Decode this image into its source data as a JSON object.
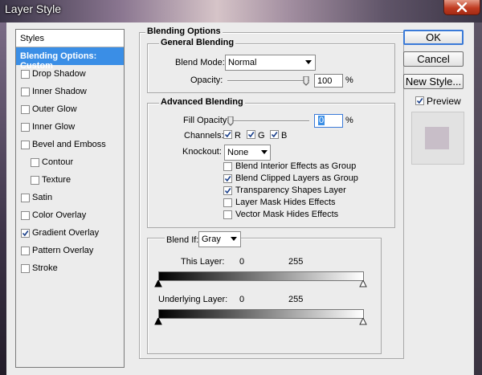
{
  "window": {
    "title": "Layer Style"
  },
  "styles_panel": {
    "header": "Styles",
    "items": [
      {
        "label": "Blending Options: Custom",
        "selected": true,
        "checkbox": false,
        "checked": false,
        "indent": false
      },
      {
        "label": "Drop Shadow",
        "selected": false,
        "checkbox": true,
        "checked": false,
        "indent": false
      },
      {
        "label": "Inner Shadow",
        "selected": false,
        "checkbox": true,
        "checked": false,
        "indent": false
      },
      {
        "label": "Outer Glow",
        "selected": false,
        "checkbox": true,
        "checked": false,
        "indent": false
      },
      {
        "label": "Inner Glow",
        "selected": false,
        "checkbox": true,
        "checked": false,
        "indent": false
      },
      {
        "label": "Bevel and Emboss",
        "selected": false,
        "checkbox": true,
        "checked": false,
        "indent": false
      },
      {
        "label": "Contour",
        "selected": false,
        "checkbox": true,
        "checked": false,
        "indent": true
      },
      {
        "label": "Texture",
        "selected": false,
        "checkbox": true,
        "checked": false,
        "indent": true
      },
      {
        "label": "Satin",
        "selected": false,
        "checkbox": true,
        "checked": false,
        "indent": false
      },
      {
        "label": "Color Overlay",
        "selected": false,
        "checkbox": true,
        "checked": false,
        "indent": false
      },
      {
        "label": "Gradient Overlay",
        "selected": false,
        "checkbox": true,
        "checked": true,
        "indent": false
      },
      {
        "label": "Pattern Overlay",
        "selected": false,
        "checkbox": true,
        "checked": false,
        "indent": false
      },
      {
        "label": "Stroke",
        "selected": false,
        "checkbox": true,
        "checked": false,
        "indent": false
      }
    ]
  },
  "blending": {
    "title": "Blending Options",
    "general": {
      "title": "General Blending",
      "blend_mode_label": "Blend Mode:",
      "blend_mode_value": "Normal",
      "opacity_label": "Opacity:",
      "opacity_value": "100",
      "opacity_fraction": 1.0,
      "percent": "%"
    },
    "advanced": {
      "title": "Advanced Blending",
      "fill_opacity_label": "Fill Opacity:",
      "fill_opacity_value": "0",
      "fill_opacity_fraction": 0.0,
      "percent": "%",
      "channels_label": "Channels:",
      "channels": [
        {
          "label": "R",
          "checked": true
        },
        {
          "label": "G",
          "checked": true
        },
        {
          "label": "B",
          "checked": true
        }
      ],
      "knockout_label": "Knockout:",
      "knockout_value": "None",
      "options": [
        {
          "label": "Blend Interior Effects as Group",
          "checked": false
        },
        {
          "label": "Blend Clipped Layers as Group",
          "checked": true
        },
        {
          "label": "Transparency Shapes Layer",
          "checked": true
        },
        {
          "label": "Layer Mask Hides Effects",
          "checked": false
        },
        {
          "label": "Vector Mask Hides Effects",
          "checked": false
        }
      ]
    },
    "blend_if": {
      "label": "Blend If:",
      "value": "Gray",
      "this_layer_label": "This Layer:",
      "this_layer_min": "0",
      "this_layer_max": "255",
      "underlying_label": "Underlying Layer:",
      "underlying_min": "0",
      "underlying_max": "255"
    }
  },
  "buttons": {
    "ok": "OK",
    "cancel": "Cancel",
    "new_style": "New Style...",
    "preview_label": "Preview",
    "preview_checked": true
  },
  "colors": {
    "selection": "#3a8ee6",
    "preview_swatch": "#c8bec8",
    "dialog_bg": "#ececec"
  }
}
